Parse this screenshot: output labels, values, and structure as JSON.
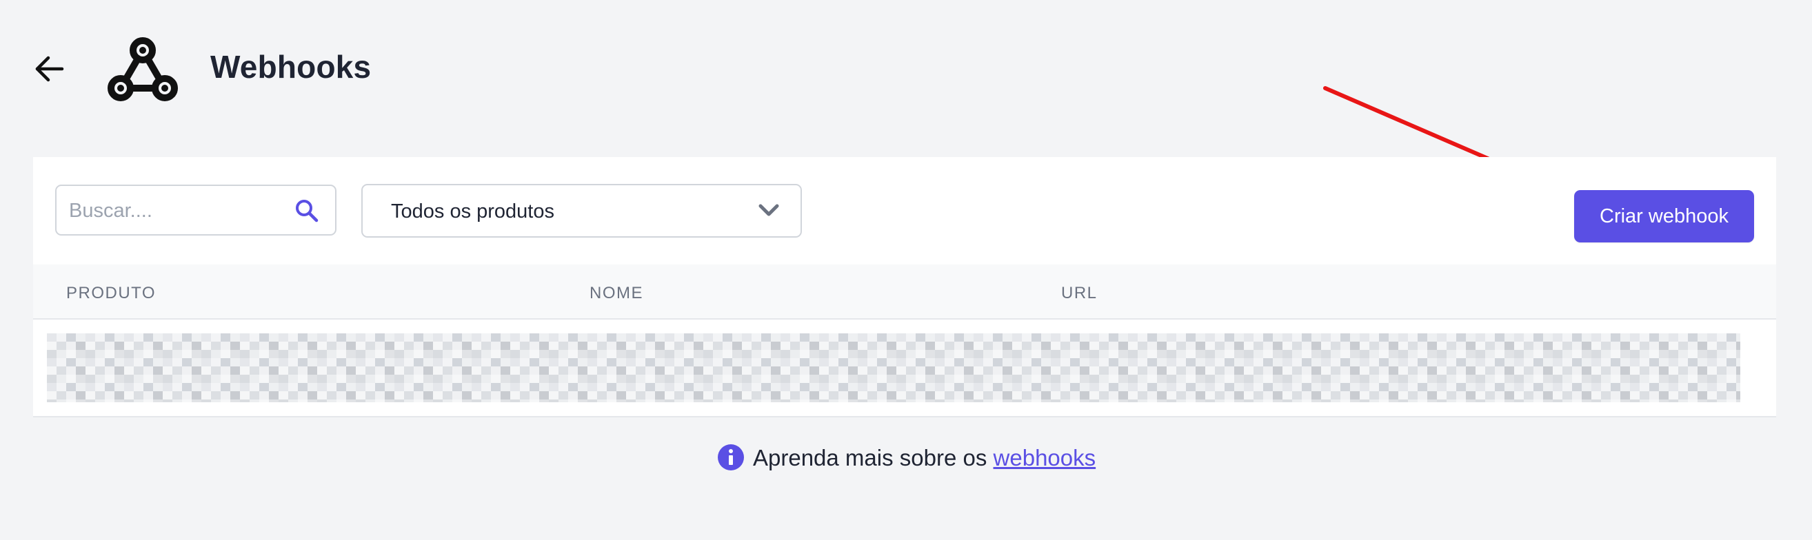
{
  "header": {
    "title": "Webhooks",
    "back_icon": "arrow-left-icon",
    "logo_icon": "webhook-icon"
  },
  "toolbar": {
    "search_placeholder": "Buscar....",
    "search_value": "",
    "search_icon": "search-icon",
    "product_filter_value": "Todos os produtos",
    "create_button_label": "Criar webhook"
  },
  "table": {
    "columns": [
      "PRODUTO",
      "NOME",
      "URL"
    ],
    "rows_redacted": true
  },
  "footer": {
    "info_icon": "info-icon",
    "text": "Aprenda mais sobre os",
    "link_text": "webhooks"
  },
  "colors": {
    "accent": "#5a4fe4",
    "annotation_arrow": "#e81616",
    "background": "#f3f4f6"
  }
}
